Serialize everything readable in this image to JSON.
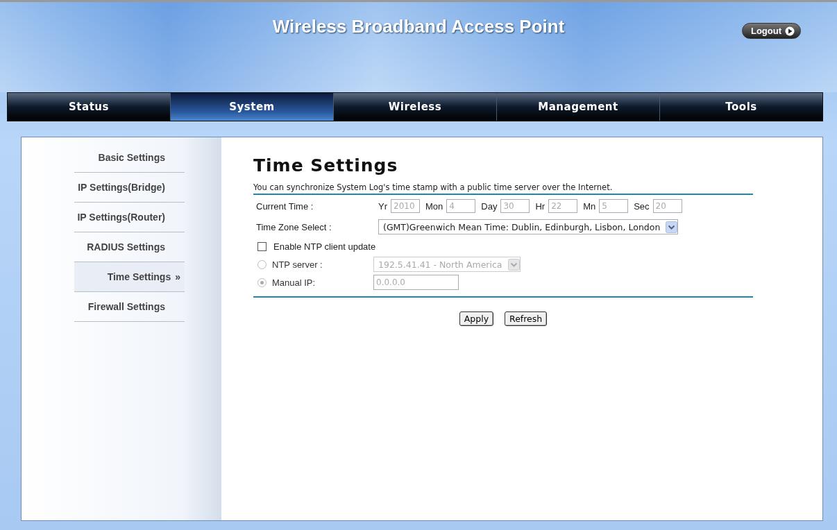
{
  "header": {
    "title": "Wireless Broadband Access Point",
    "logout": "Logout"
  },
  "nav": [
    {
      "label": "Status",
      "selected": false
    },
    {
      "label": "System",
      "selected": true
    },
    {
      "label": "Wireless",
      "selected": false
    },
    {
      "label": "Management",
      "selected": false
    },
    {
      "label": "Tools",
      "selected": false
    }
  ],
  "sidebar": [
    {
      "label": "Basic Settings",
      "selected": false
    },
    {
      "label": "IP Settings(Bridge)",
      "selected": false
    },
    {
      "label": "IP Settings(Router)",
      "selected": false
    },
    {
      "label": "RADIUS Settings",
      "selected": false
    },
    {
      "label": "Time Settings",
      "selected": true,
      "marker": "»"
    },
    {
      "label": "Firewall Settings",
      "selected": false
    }
  ],
  "page": {
    "title": "Time Settings",
    "description": "You can synchronize System Log's time stamp with a public time server over the Internet.",
    "current_time": {
      "label": "Current Time :",
      "fields": [
        {
          "label": "Yr",
          "value": "2010",
          "disabled": true
        },
        {
          "label": "Mon",
          "value": "4",
          "disabled": true
        },
        {
          "label": "Day",
          "value": "30",
          "disabled": true
        },
        {
          "label": "Hr",
          "value": "22",
          "disabled": true
        },
        {
          "label": "Mn",
          "value": "5",
          "disabled": true
        },
        {
          "label": "Sec",
          "value": "20",
          "disabled": true
        }
      ]
    },
    "time_zone": {
      "label": "Time Zone Select :",
      "value": "(GMT)Greenwich Mean Time: Dublin, Edinburgh, Lisbon, London",
      "disabled": false
    },
    "ntp_update": {
      "label": "Enable NTP client update",
      "checked": false
    },
    "ntp_options": [
      {
        "kind": "select",
        "label": "NTP server :",
        "selected": false,
        "value": "192.5.41.41 - North America",
        "disabled": true
      },
      {
        "kind": "input",
        "label": "Manual IP:",
        "selected": true,
        "value": "0.0.0.0",
        "disabled": true
      }
    ],
    "buttons": [
      "Apply",
      "Refresh"
    ]
  }
}
